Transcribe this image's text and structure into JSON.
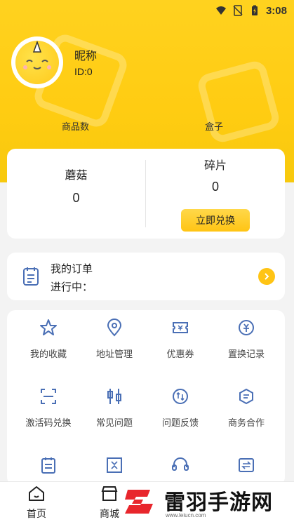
{
  "status_bar": {
    "time": "3:08",
    "icons": [
      "wifi-icon",
      "no-sim-icon",
      "battery-icon"
    ]
  },
  "profile": {
    "nickname": "昵称",
    "user_id": "ID:0"
  },
  "stats": {
    "goods_label": "商品数",
    "box_label": "盒子"
  },
  "wallet": {
    "mushroom_label": "蘑菇",
    "mushroom_value": "0",
    "fragment_label": "碎片",
    "fragment_value": "0",
    "redeem_button": "立即兑换"
  },
  "orders": {
    "title": "我的订单",
    "status": "进行中："
  },
  "services": [
    {
      "label": "我的收藏",
      "icon": "star-icon"
    },
    {
      "label": "地址管理",
      "icon": "location-pin-icon"
    },
    {
      "label": "优惠券",
      "icon": "coupon-icon"
    },
    {
      "label": "置换记录",
      "icon": "exchange-record-icon"
    },
    {
      "label": "激活码兑换",
      "icon": "scan-code-icon"
    },
    {
      "label": "常见问题",
      "icon": "question-list-icon"
    },
    {
      "label": "问题反馈",
      "icon": "feedback-icon"
    },
    {
      "label": "商务合作",
      "icon": "business-icon"
    },
    {
      "label": "",
      "icon": "clipboard-icon"
    },
    {
      "label": "",
      "icon": "grid-scan-icon"
    },
    {
      "label": "",
      "icon": "headset-icon"
    },
    {
      "label": "",
      "icon": "swap-icon"
    }
  ],
  "tabbar": {
    "home": "首页",
    "mall": "商城"
  },
  "watermark": {
    "text": "雷羽手游网",
    "url": "www.leiucn.com"
  },
  "colors": {
    "brand_yellow": "#ffcc12",
    "accent": "#ffc414"
  }
}
